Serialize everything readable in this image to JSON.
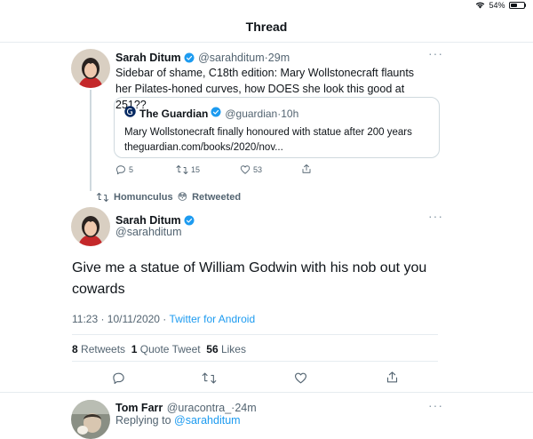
{
  "status_bar": {
    "battery": "54%",
    "battery_level": 0.54
  },
  "header": {
    "title": "Thread"
  },
  "tweet1": {
    "name": "Sarah Ditum",
    "handle": "@sarahditum",
    "sep": "·",
    "time": "29m",
    "text": "Sidebar of shame, C18th edition: Mary Wollstonecraft flaunts her Pilates-honed curves, how DOES she look this good at 251??",
    "quote": {
      "name": "The Guardian",
      "handle": "@guardian",
      "time": "10h",
      "text": "Mary Wollstonecraft finally honoured with statue after 200 years",
      "url": "theguardian.com/books/2020/nov..."
    },
    "actions": {
      "replies": "5",
      "retweets": "15",
      "likes": "53"
    }
  },
  "retweet_bar": {
    "by": "Homunculus",
    "emoji": "😳",
    "label": "Retweeted"
  },
  "main_tweet": {
    "name": "Sarah Ditum",
    "handle": "@sarahditum",
    "text": "Give me a statue of William Godwin with his nob out you cowards",
    "time": "11:23 · 10/11/2020 ·",
    "source": "Twitter for Android",
    "stats": {
      "retweets_num": "8",
      "retweets_label": "Retweets",
      "quotes_num": "1",
      "quotes_label": "Quote Tweet",
      "likes_num": "56",
      "likes_label": "Likes"
    }
  },
  "reply": {
    "name": "Tom Farr",
    "handle": "@uracontra_",
    "time": "24m",
    "replying_prefix": "Replying to",
    "replying_to": "@sarahditum"
  },
  "colors": {
    "accent": "#1d9bf0",
    "muted": "#536471",
    "divider": "#e6ecf0"
  }
}
